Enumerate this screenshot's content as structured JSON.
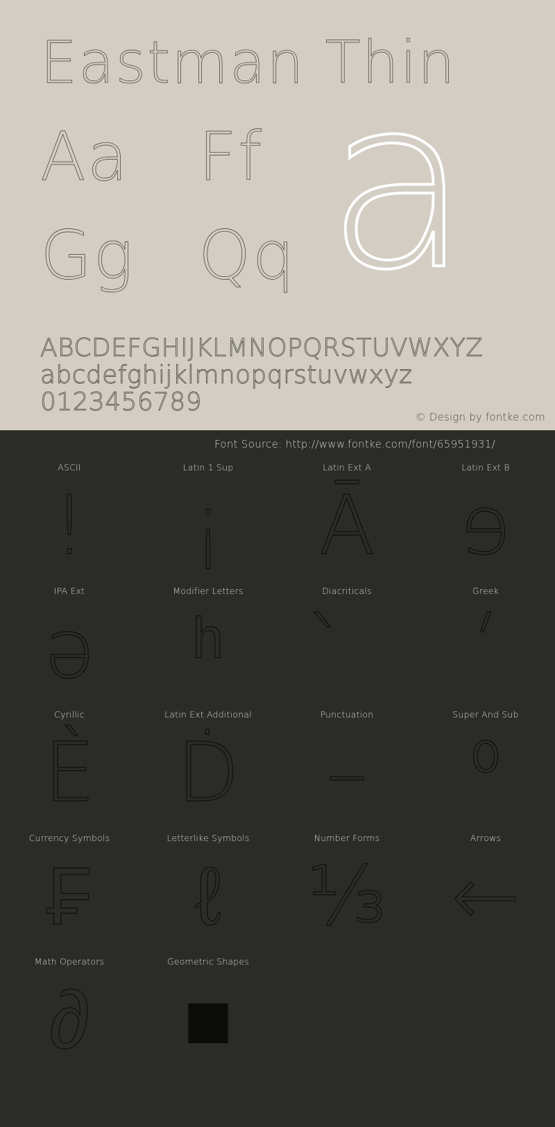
{
  "colors": {
    "specimen_bg": "#d3cdc3",
    "coverage_bg": "#2b2b27",
    "glyph_ink": "#0e0e0c",
    "specimen_ink": "#3a3a35",
    "watermark": "#ffffff",
    "label_text": "#d4d3cd"
  },
  "specimen": {
    "title": "Eastman Thin",
    "pairs": [
      {
        "name": "aa",
        "text": "Aa"
      },
      {
        "name": "ff",
        "text": "Ff"
      },
      {
        "name": "gg",
        "text": "Gg"
      },
      {
        "name": "qq",
        "text": "Qq"
      }
    ],
    "watermark_glyph": "a",
    "uppercase": "ABCDEFGHIJKLMNOPQRSTUVWXYZ",
    "lowercase": "abcdefghijklmnopqrstuvwxyz",
    "digits": "0123456789",
    "copyright": "© Design by fontke.com"
  },
  "coverage": {
    "source": "Font Source: http://www.fontke.com/font/65951931/",
    "blocks": [
      {
        "label": "ASCII",
        "glyph": "!",
        "solid": false
      },
      {
        "label": "Latin 1 Sup",
        "glyph": "¡",
        "solid": false
      },
      {
        "label": "Latin Ext A",
        "glyph": "Ā",
        "solid": false
      },
      {
        "label": "Latin Ext B",
        "glyph": "ɘ",
        "solid": false
      },
      {
        "label": "IPA Ext",
        "glyph": "ə",
        "solid": false
      },
      {
        "label": "Modifier Letters",
        "glyph": "ʰ",
        "solid": false
      },
      {
        "label": "Diacriticals",
        "glyph": "̀",
        "solid": false
      },
      {
        "label": "Greek",
        "glyph": "ʹ",
        "solid": false
      },
      {
        "label": "Cyrillic",
        "glyph": "Ѐ",
        "solid": false
      },
      {
        "label": "Latin Ext Additional",
        "glyph": "Ḋ",
        "solid": false
      },
      {
        "label": "Punctuation",
        "glyph": "–",
        "solid": false
      },
      {
        "label": "Super And Sub",
        "glyph": "⁰",
        "solid": false
      },
      {
        "label": "Currency Symbols",
        "glyph": "₣",
        "solid": false
      },
      {
        "label": "Letterlike Symbols",
        "glyph": "ℓ",
        "solid": false
      },
      {
        "label": "Number Forms",
        "glyph": "⅓",
        "solid": false
      },
      {
        "label": "Arrows",
        "glyph": "←",
        "solid": false
      },
      {
        "label": "Math Operators",
        "glyph": "∂",
        "solid": false
      },
      {
        "label": "Geometric Shapes",
        "glyph": "■",
        "solid": true
      },
      {
        "label": "",
        "glyph": "",
        "solid": false
      },
      {
        "label": "",
        "glyph": "",
        "solid": false
      }
    ]
  }
}
